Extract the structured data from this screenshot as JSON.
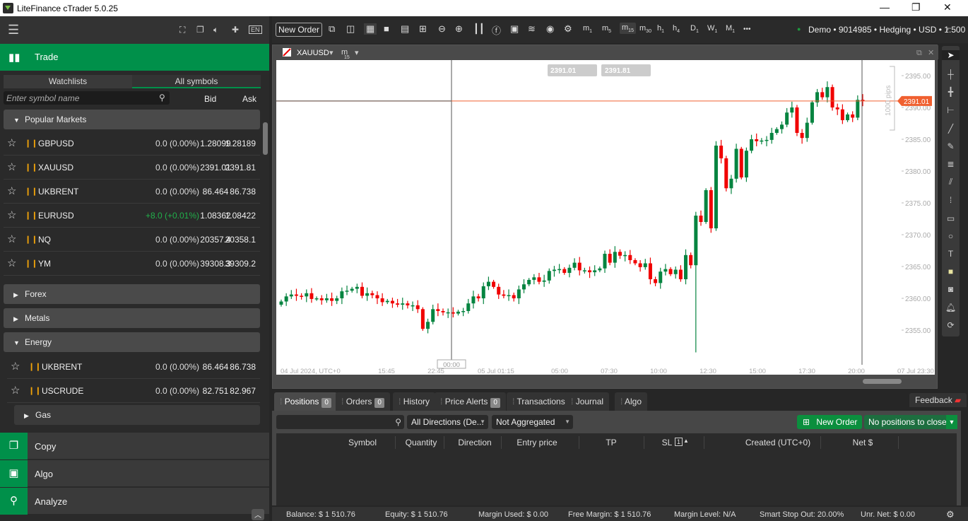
{
  "window": {
    "title": "LiteFinance cTrader 5.0.25",
    "min": "—",
    "max": "❐",
    "close": "✕"
  },
  "left": {
    "lang": "EN",
    "trade_label": "Trade",
    "tabs": [
      "Watchlists",
      "All symbols"
    ],
    "search_placeholder": "Enter symbol name",
    "bid_header": "Bid",
    "ask_header": "Ask",
    "popular": {
      "label": "Popular Markets",
      "rows": [
        {
          "symbol": "GBPUSD",
          "change": "0.0 (0.00%)",
          "bid": "1.28099",
          "ask": "1.28189",
          "up": false
        },
        {
          "symbol": "XAUUSD",
          "change": "0.0 (0.00%)",
          "bid": "2391.01",
          "ask": "2391.81",
          "up": false
        },
        {
          "symbol": "UKBRENT",
          "change": "0.0 (0.00%)",
          "bid": "86.464",
          "ask": "86.738",
          "up": false
        },
        {
          "symbol": "EURUSD",
          "change": "+8.0 (+0.01%)",
          "bid": "1.08362",
          "ask": "1.08422",
          "up": true
        },
        {
          "symbol": "NQ",
          "change": "0.0 (0.00%)",
          "bid": "20357.4",
          "ask": "20358.1",
          "up": false
        },
        {
          "symbol": "YM",
          "change": "0.0 (0.00%)",
          "bid": "39308.3",
          "ask": "39309.2",
          "up": false
        }
      ]
    },
    "groups": [
      "Forex",
      "Metals",
      "Energy"
    ],
    "energy_rows": [
      {
        "symbol": "UKBRENT",
        "change": "0.0 (0.00%)",
        "bid": "86.464",
        "ask": "86.738"
      },
      {
        "symbol": "USCRUDE",
        "change": "0.0 (0.00%)",
        "bid": "82.751",
        "ask": "82.967"
      }
    ],
    "sub_group": "Gas",
    "bottom": [
      "Copy",
      "Algo",
      "Analyze"
    ]
  },
  "toolbar": {
    "new_order": "New Order",
    "timeframes": [
      [
        "m",
        "1"
      ],
      [
        "m",
        "5"
      ],
      [
        "m",
        "15"
      ],
      [
        "m",
        "30"
      ],
      [
        "h",
        "1"
      ],
      [
        "h",
        "4"
      ],
      [
        "D",
        "1"
      ],
      [
        "W",
        "1"
      ],
      [
        "M",
        "1"
      ]
    ],
    "active_tf": "m15",
    "more": "•••",
    "account": "Demo • 9014985 • Hedging • USD • 1:500"
  },
  "chart": {
    "symbol": "XAUUSD",
    "timeframe_main": "m",
    "timeframe_sub": "15",
    "bid_box": "2391.01",
    "ask_box": "2391.81",
    "price_tag": "2391.01",
    "pips_label": "1000 pips",
    "crosshair_time": "00:00",
    "colors": {
      "up": "#068440",
      "down": "#f00000",
      "price_line": "#f06030"
    }
  },
  "chart_data": {
    "type": "candlestick",
    "symbol": "XAUUSD",
    "timeframe": "m15",
    "ylim": [
      2351,
      2397
    ],
    "y_ticks": [
      "2395.00",
      "2390.00",
      "2385.00",
      "2380.00",
      "2375.00",
      "2370.00",
      "2365.00",
      "2360.00",
      "2355.00"
    ],
    "x_ticks": [
      "04 Jul 2024, UTC+0",
      "15:45",
      "22:45",
      "05 Jul 01:15",
      "05:00",
      "07:30",
      "10:00",
      "12:30",
      "15:00",
      "17:30",
      "20:00",
      "07 Jul 23:30"
    ],
    "first_open": 2359.0,
    "close": [
      2359.5,
      2360.3,
      2360.6,
      2360.4,
      2360.3,
      2360.8,
      2359.9,
      2360.0,
      2359.7,
      2360.0,
      2359.6,
      2360.0,
      2361.1,
      2361.2,
      2361.5,
      2361.8,
      2360.4,
      2360.8,
      2360.5,
      2360.0,
      2359.4,
      2359.6,
      2359.2,
      2359.0,
      2359.2,
      2358.9,
      2358.9,
      2358.3,
      2355.2,
      2356.3,
      2358.3,
      2358.0,
      2357.8,
      2357.8,
      2357.6,
      2357.9,
      2358.0,
      2359.2,
      2360.3,
      2360.0,
      2361.9,
      2362.6,
      2361.8,
      2360.6,
      2360.4,
      2360.5,
      2360.0,
      2361.4,
      2362.2,
      2362.9,
      2363.3,
      2362.6,
      2362.8,
      2364.3,
      2364.5,
      2364.6,
      2364.0,
      2364.8,
      2365.6,
      2364.4,
      2364.4,
      2364.1,
      2364.4,
      2364.7,
      2367.0,
      2365.6,
      2367.3,
      2366.7,
      2366.8,
      2366.0,
      2365.5,
      2364.9,
      2365.5,
      2363.0,
      2362.4,
      2364.2,
      2364.6,
      2363.8,
      2364.5,
      2363.0,
      2366.8,
      2365.2,
      2373.0,
      2372.0,
      2377.0,
      2371.0,
      2384.0,
      2382.0,
      2377.3,
      2378.8,
      2383.5,
      2379.0,
      2383.2,
      2385.0,
      2384.7,
      2384.8,
      2384.9,
      2386.0,
      2386.6,
      2387.3,
      2389.2,
      2390.0,
      2386.0,
      2385.2,
      2387.6,
      2390.8,
      2392.4,
      2391.6,
      2393.2,
      2390.0,
      2389.7,
      2388.0,
      2388.9,
      2388.4,
      2391.2,
      2391.0
    ],
    "min_low": {
      "index": 82,
      "value": 2351.5
    },
    "current_price": 2391.01,
    "grid": false
  },
  "bottom": {
    "tabs": [
      {
        "label": "Positions",
        "badge": "0"
      },
      {
        "label": "Orders",
        "badge": "0"
      },
      {
        "label": "History"
      },
      {
        "label": "Price Alerts",
        "badge": "0"
      },
      {
        "label": "Transactions"
      },
      {
        "label": "Journal"
      },
      {
        "label": "Algo"
      }
    ],
    "feedback": "Feedback",
    "direction": "All Directions (De...",
    "aggregation": "Not Aggregated",
    "new_order": "New Order",
    "close_all": "No positions to close",
    "columns": [
      "Symbol",
      "Quantity",
      "Direction",
      "Entry price",
      "TP",
      "SL",
      "Created (UTC+0)",
      "Net $"
    ],
    "sl_badge": "1"
  },
  "status": {
    "balance": "Balance: $ 1 510.76",
    "equity": "Equity: $ 1 510.76",
    "margin_used": "Margin Used: $ 0.00",
    "free_margin": "Free Margin: $ 1 510.76",
    "margin_level": "Margin Level: N/A",
    "smart_stop": "Smart Stop Out: 20.00%",
    "unr_net": "Unr. Net:  $ 0.00"
  }
}
